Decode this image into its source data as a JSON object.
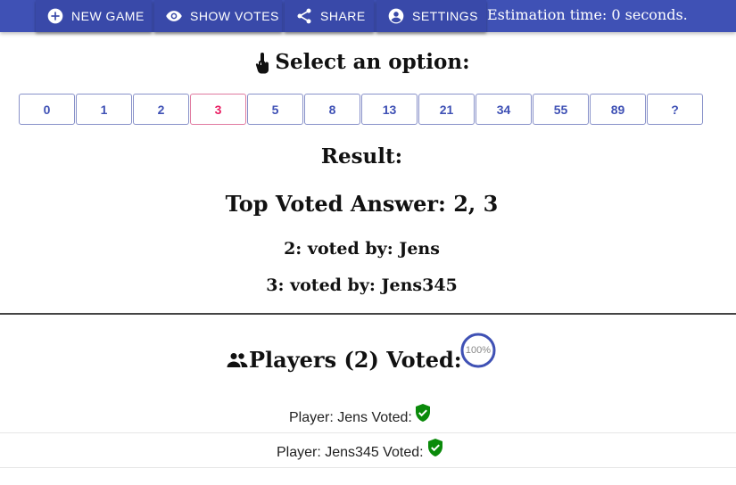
{
  "toolbar": {
    "new_game": "NEW GAME",
    "show_votes": "SHOW VOTES",
    "share": "SHARE",
    "settings": "SETTINGS",
    "estimation_time": "Estimation time: 0 seconds."
  },
  "select": {
    "title": "Select an option:"
  },
  "cards": [
    "0",
    "1",
    "2",
    "3",
    "5",
    "8",
    "13",
    "21",
    "34",
    "55",
    "89",
    "?"
  ],
  "selected_card": "3",
  "result": {
    "title": "Result:",
    "top_voted": "Top Voted Answer: 2, 3",
    "votes": [
      "2: voted by: Jens",
      "3: voted by: Jens345"
    ]
  },
  "players": {
    "title": "Players (2) Voted:",
    "progress_label": "100%",
    "progress_value": 1.0,
    "rows": [
      "Player: Jens Voted:",
      "Player: Jens345 Voted:"
    ]
  },
  "colors": {
    "primary": "#3f51b5",
    "selected": "#e91e63",
    "voted": "#0a8a0a"
  },
  "icons": {
    "new_game": "plus-circle-icon",
    "show_votes": "eye-icon",
    "share": "share-icon",
    "settings": "account-circle-icon",
    "select": "touch-app-icon",
    "players": "people-icon",
    "voted": "verified-shield-icon"
  }
}
